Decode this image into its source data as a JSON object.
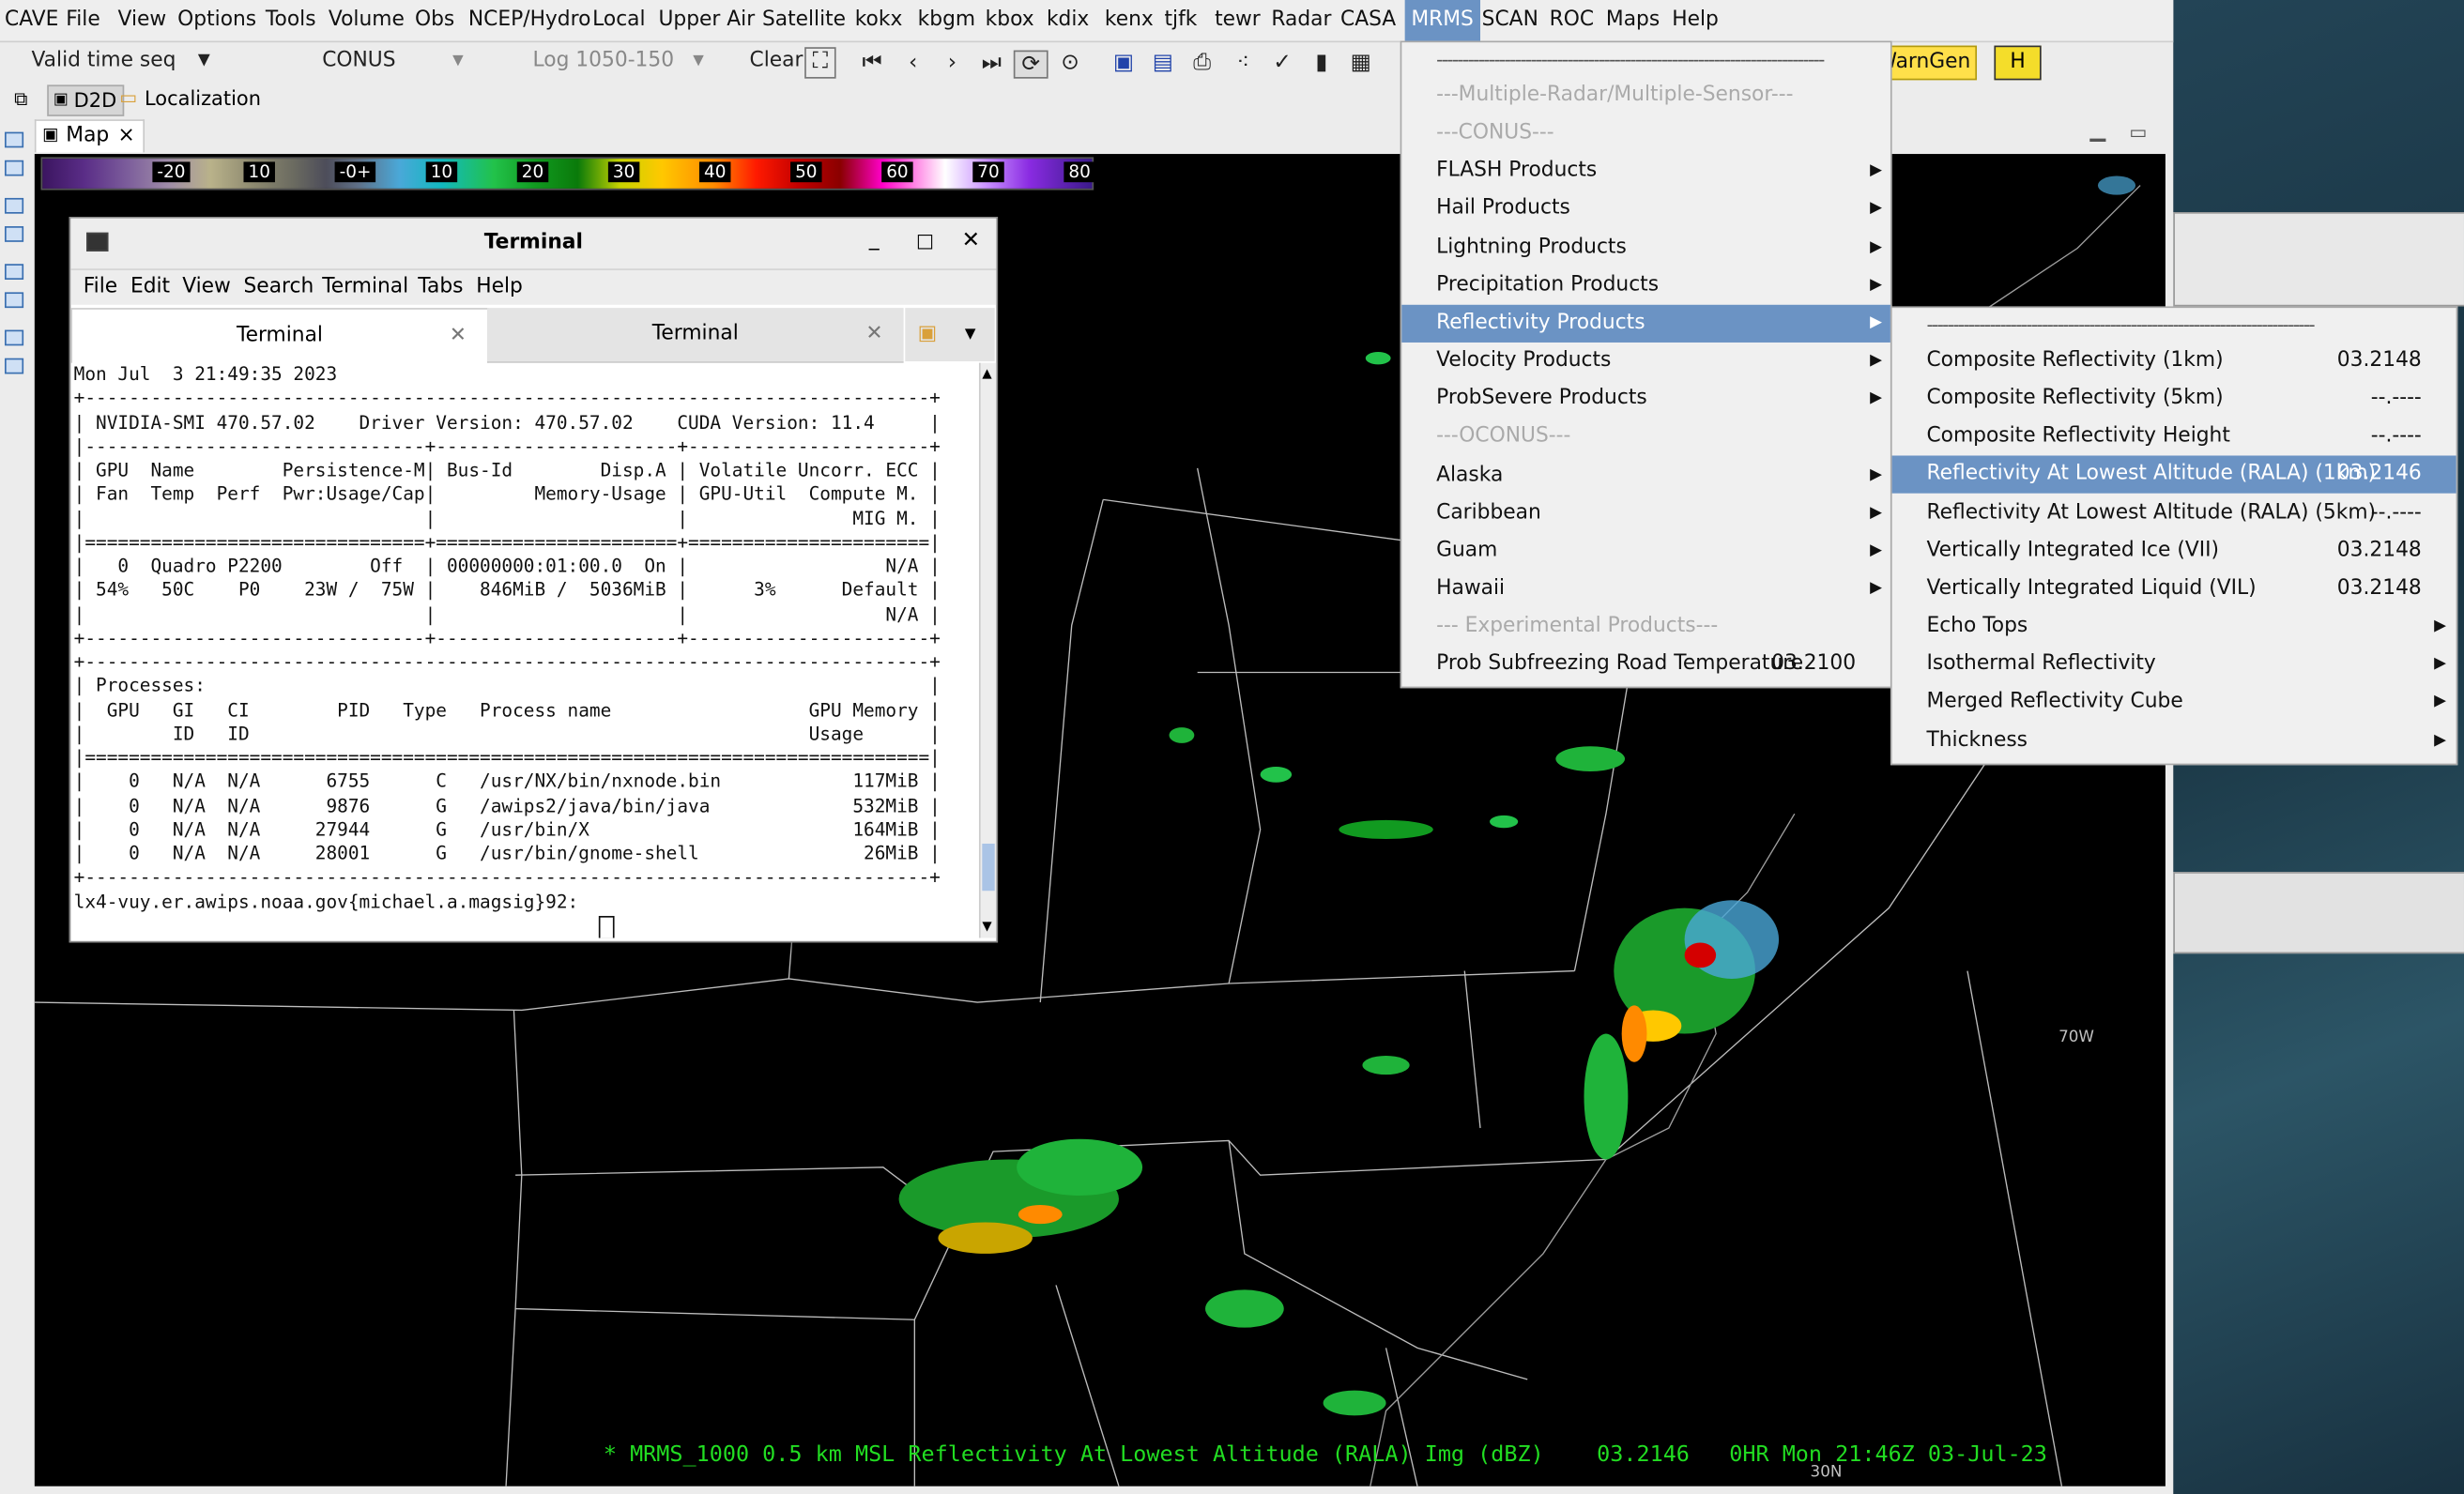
{
  "menubar": {
    "items": [
      "CAVE",
      "File",
      "View",
      "Options",
      "Tools",
      "Volume",
      "Obs",
      "NCEP/Hydro",
      "Local",
      "Upper Air",
      "Satellite",
      "kokx",
      "kbgm",
      "kbox",
      "kdix",
      "kenx",
      "tjfk",
      "tewr",
      "Radar",
      "CASA",
      "MRMS",
      "SCAN",
      "ROC",
      "Maps",
      "Help"
    ],
    "active": "MRMS"
  },
  "toolbar": {
    "time_mode": "Valid time seq",
    "scale": "CONUS",
    "load_mode": "Log 1050-150",
    "clear_label": "Clear",
    "warngen_label": "WarnGen",
    "hydro_icon_label": "H"
  },
  "perspective": {
    "d2d_label": "D2D",
    "localization_label": "Localization"
  },
  "map_tab": {
    "label": "Map"
  },
  "colorbar": {
    "labels": [
      "-20",
      "10",
      "-0+",
      "10",
      "20",
      "30",
      "40",
      "50",
      "60",
      "70",
      "80"
    ]
  },
  "map_status": {
    "text": "* MRMS_1000 0.5 km MSL Reflectivity At Lowest Altitude (RALA) Img (dBZ)    03.2146   0HR Mon 21:46Z 03-Jul-23",
    "color": "#22dd22"
  },
  "map_labels": {
    "lon_70w": "70W",
    "lat_30n": "30N"
  },
  "terminal": {
    "title": "Terminal",
    "menu": [
      "File",
      "Edit",
      "View",
      "Search",
      "Terminal",
      "Tabs",
      "Help"
    ],
    "tabs": [
      "Terminal",
      "Terminal"
    ],
    "lines": [
      "Mon Jul  3 21:49:35 2023",
      "+-----------------------------------------------------------------------------+",
      "| NVIDIA-SMI 470.57.02    Driver Version: 470.57.02    CUDA Version: 11.4     |",
      "|-------------------------------+----------------------+----------------------+",
      "| GPU  Name        Persistence-M| Bus-Id        Disp.A | Volatile Uncorr. ECC |",
      "| Fan  Temp  Perf  Pwr:Usage/Cap|         Memory-Usage | GPU-Util  Compute M. |",
      "|                               |                      |               MIG M. |",
      "|===============================+======================+======================|",
      "|   0  Quadro P2200        Off  | 00000000:01:00.0  On |                  N/A |",
      "| 54%   50C    P0    23W /  75W |    846MiB /  5036MiB |      3%      Default |",
      "|                               |                      |                  N/A |",
      "+-------------------------------+----------------------+----------------------+",
      "",
      "+-----------------------------------------------------------------------------+",
      "| Processes:                                                                  |",
      "|  GPU   GI   CI        PID   Type   Process name                  GPU Memory |",
      "|        ID   ID                                                   Usage      |",
      "|=============================================================================|",
      "|    0   N/A  N/A      6755      C   /usr/NX/bin/nxnode.bin            117MiB |",
      "|    0   N/A  N/A      9876      G   /awips2/java/bin/java             532MiB |",
      "|    0   N/A  N/A     27944      G   /usr/bin/X                        164MiB |",
      "|    0   N/A  N/A     28001      G   /usr/bin/gnome-shell               26MiB |",
      "+-----------------------------------------------------------------------------+",
      "lx4-vuy.er.awips.noaa.gov{michael.a.magsig}92: "
    ]
  },
  "mrms_menu": {
    "separator_top": "--------------------------------------------------------------------------",
    "items": [
      {
        "label": "---Multiple-Radar/Multiple-Sensor---",
        "disabled": true
      },
      {
        "label": "---CONUS---",
        "disabled": true
      },
      {
        "label": "FLASH Products",
        "submenu": true
      },
      {
        "label": "Hail Products",
        "submenu": true
      },
      {
        "label": "Lightning Products",
        "submenu": true
      },
      {
        "label": "Precipitation Products",
        "submenu": true
      },
      {
        "label": "Reflectivity Products",
        "submenu": true,
        "selected": true
      },
      {
        "label": "Velocity Products",
        "submenu": true
      },
      {
        "label": "ProbSevere Products",
        "submenu": true
      },
      {
        "label": "---OCONUS---",
        "disabled": true
      },
      {
        "label": "Alaska",
        "submenu": true
      },
      {
        "label": "Caribbean",
        "submenu": true
      },
      {
        "label": "Guam",
        "submenu": true
      },
      {
        "label": "Hawaii",
        "submenu": true
      },
      {
        "label": "--- Experimental Products---",
        "disabled": true
      },
      {
        "label": "Prob Subfreezing Road Temperature",
        "value": "03.2100"
      }
    ]
  },
  "reflectivity_menu": {
    "separator_top": "--------------------------------------------------------------------------",
    "items": [
      {
        "label": "Composite Reflectivity (1km)",
        "value": "03.2148"
      },
      {
        "label": "Composite Reflectivity (5km)",
        "value": "--.----"
      },
      {
        "label": "Composite Reflectivity Height",
        "value": "--.----"
      },
      {
        "label": "Reflectivity At Lowest Altitude (RALA) (1km)",
        "value": "03.2146",
        "selected": true
      },
      {
        "label": "Reflectivity At Lowest Altitude (RALA) (5km)",
        "value": "--.----"
      },
      {
        "label": "Vertically Integrated Ice (VII)",
        "value": "03.2148"
      },
      {
        "label": "Vertically Integrated Liquid (VIL)",
        "value": "03.2148"
      },
      {
        "label": "Echo Tops",
        "submenu": true
      },
      {
        "label": "Isothermal Reflectivity",
        "submenu": true
      },
      {
        "label": "Merged Reflectivity Cube",
        "submenu": true
      },
      {
        "label": "Thickness",
        "submenu": true
      }
    ]
  }
}
